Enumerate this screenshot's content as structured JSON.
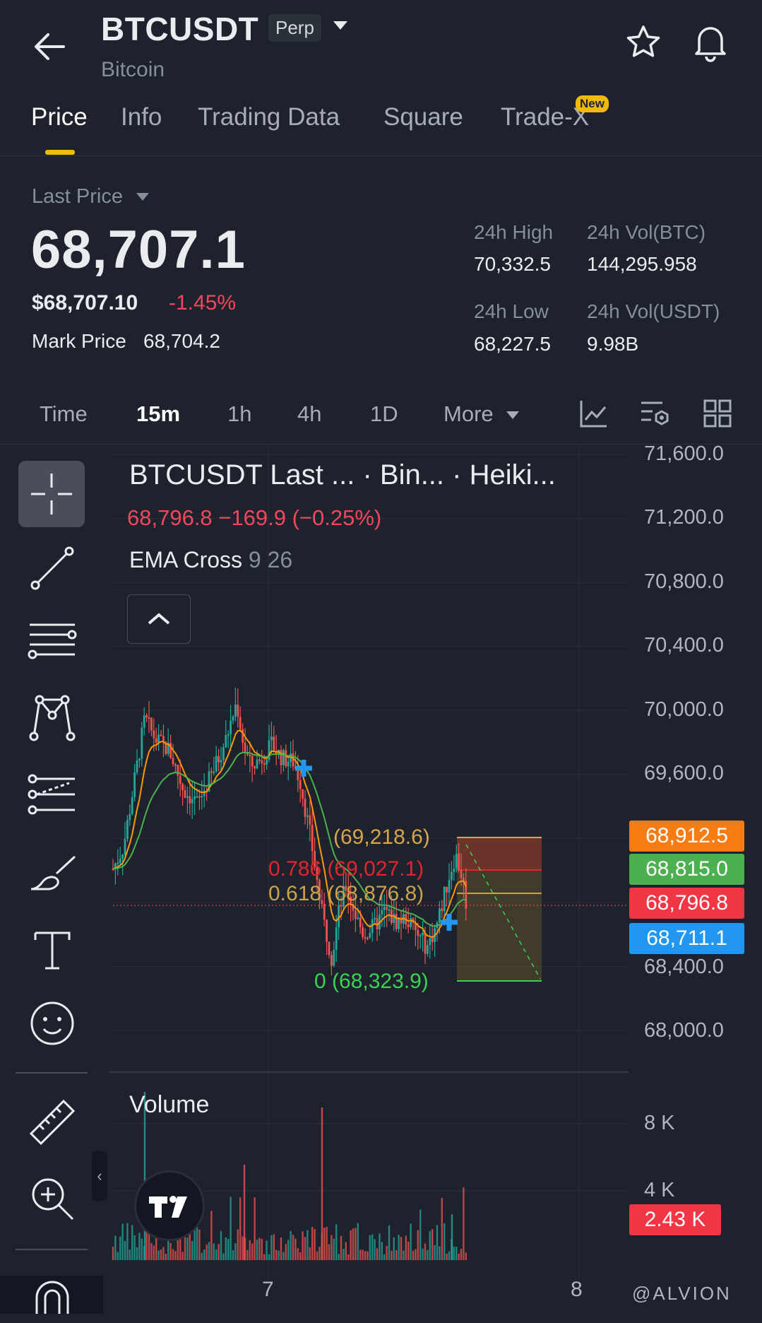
{
  "header": {
    "symbol": "BTCUSDT",
    "badge": "Perp",
    "subtitle": "Bitcoin"
  },
  "tabs": [
    {
      "label": "Price",
      "active": true
    },
    {
      "label": "Info"
    },
    {
      "label": "Trading Data"
    },
    {
      "label": "Square"
    },
    {
      "label": "Trade-X",
      "badge": "New"
    }
  ],
  "price": {
    "label": "Last Price",
    "last": "68,707.1",
    "usd": "$68,707.10",
    "change_pct": "-1.45%",
    "mark_label": "Mark Price",
    "mark_value": "68,704.2"
  },
  "stats": {
    "high_label": "24h High",
    "high": "70,332.5",
    "low_label": "24h Low",
    "low": "68,227.5",
    "volbtc_label": "24h Vol(BTC)",
    "volbtc": "144,295.958",
    "volusdt_label": "24h Vol(USDT)",
    "volusdt": "9.98B"
  },
  "intervals": [
    "Time",
    "15m",
    "1h",
    "4h",
    "1D",
    "More"
  ],
  "chart": {
    "legend_title": "BTCUSDT Last ...   · Bin...   · Heiki...",
    "legend_quote": "68,796.8  −169.9 (−0.25%)",
    "ema_label": "EMA Cross",
    "ema_params": "9 26",
    "volume_label": "Volume",
    "price_axis": [
      "71,600.0",
      "71,200.0",
      "70,800.0",
      "70,400.0",
      "70,000.0",
      "69,600.0",
      "68,400.0",
      "68,000.0"
    ],
    "volume_axis": [
      "8 K",
      "4 K"
    ],
    "price_tags": [
      {
        "value": "68,912.5",
        "color": "#f77c14"
      },
      {
        "value": "68,815.0",
        "color": "#4caf50"
      },
      {
        "value": "68,796.8",
        "color": "#f23645"
      },
      {
        "value": "68,711.1",
        "color": "#2196f3"
      }
    ],
    "volume_tag": "2.43 K",
    "fib_levels": {
      "top": "(69,218.6)",
      "l786": "0.786 (69,027.1)",
      "l618": "0.618 (68,876.8)",
      "zero": "0 (68,323.9)"
    },
    "x_labels": [
      "7",
      "8"
    ],
    "colors": {
      "up": "#26a69a",
      "down": "#ef5350",
      "ema_fast": "#ff9800",
      "ema_slow": "#4caf50"
    }
  },
  "watermark": "@ALVION"
}
